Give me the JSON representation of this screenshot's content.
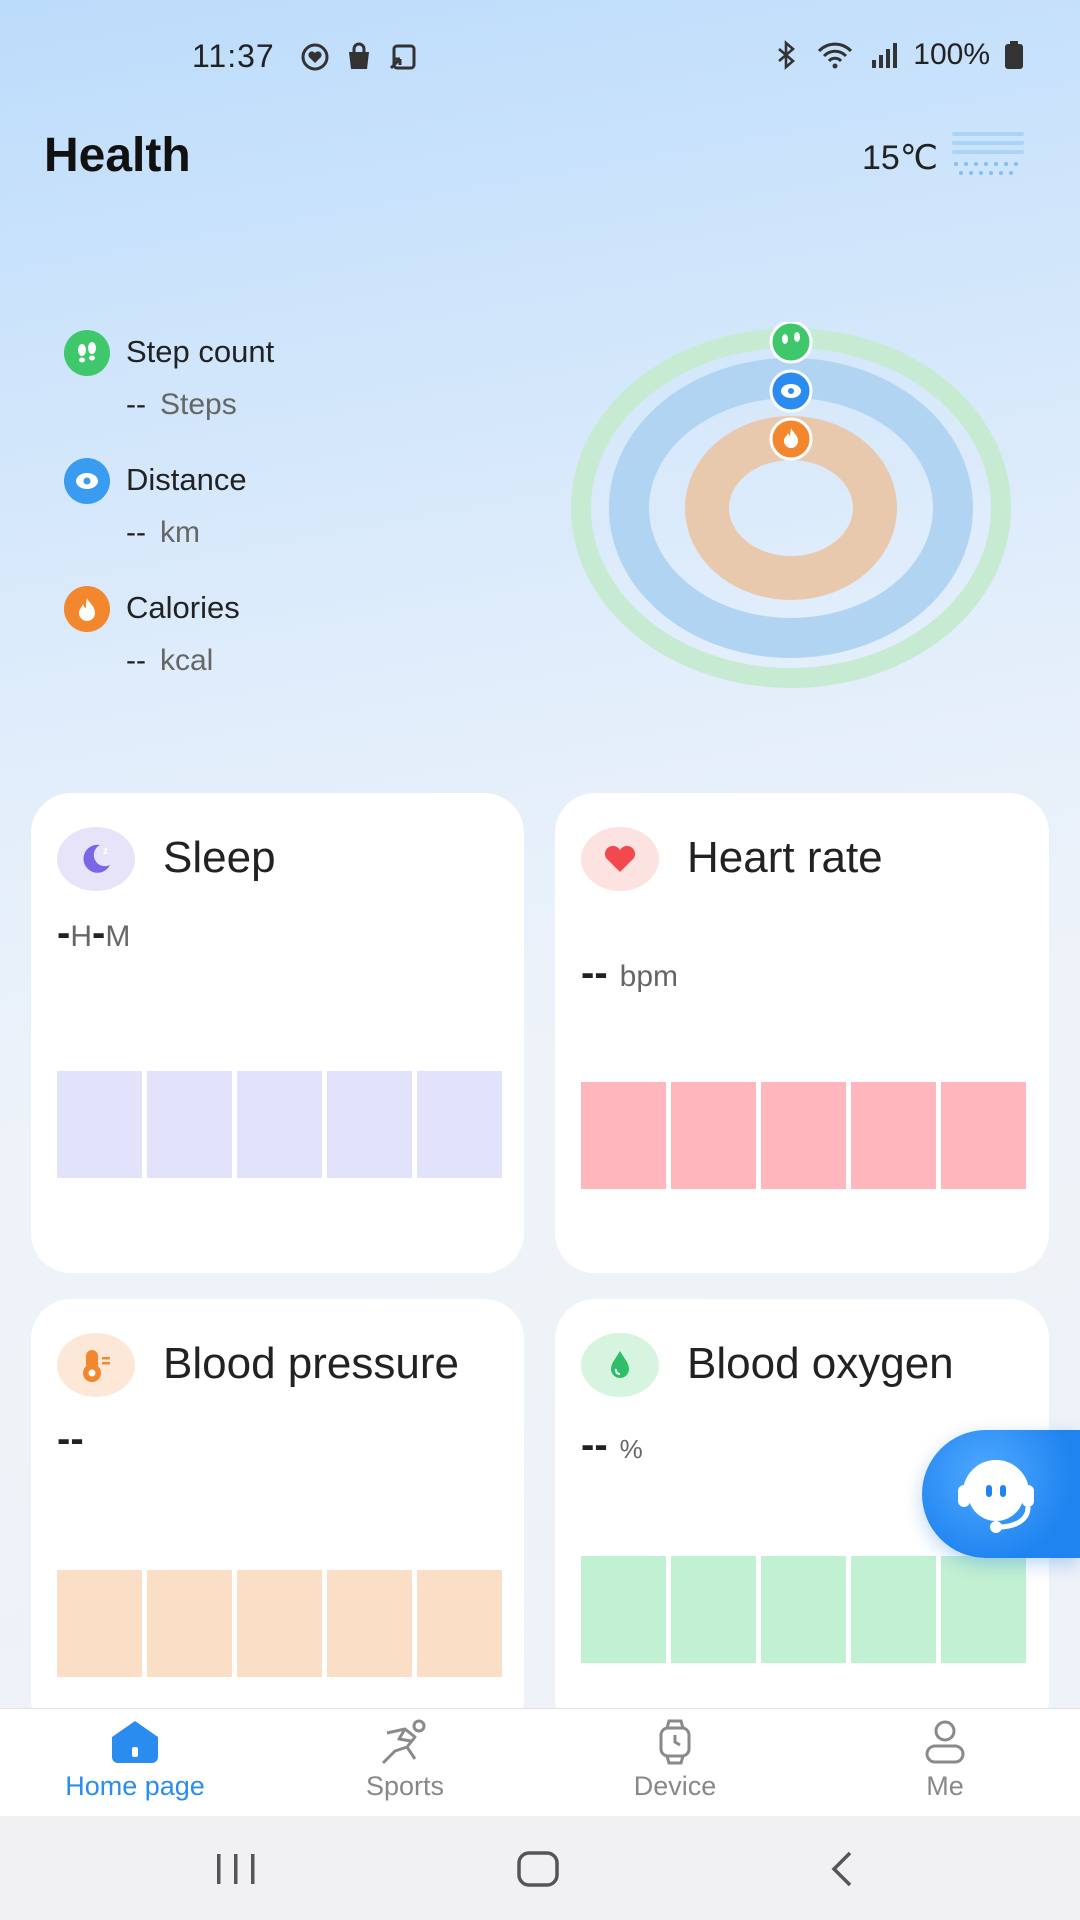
{
  "status_bar": {
    "time": "11:37",
    "battery": "100%"
  },
  "header": {
    "title": "Health",
    "temperature": "15℃",
    "weather_icon": "fog-icon"
  },
  "activity": [
    {
      "label": "Step count",
      "value": "--",
      "unit": "Steps",
      "icon": "footprints-icon",
      "color": "#3ec76b"
    },
    {
      "label": "Distance",
      "value": "--",
      "unit": "km",
      "icon": "location-icon",
      "color": "#3a9cf0"
    },
    {
      "label": "Calories",
      "value": "--",
      "unit": "kcal",
      "icon": "flame-icon",
      "color": "#f2872e"
    }
  ],
  "cards": {
    "sleep": {
      "title": "Sleep",
      "value_h": "-",
      "label_h": "H",
      "value_m": "-",
      "label_m": "M",
      "bar_color": "#e2e2fa"
    },
    "heart_rate": {
      "title": "Heart rate",
      "value": "--",
      "unit": "bpm",
      "bar_color": "#ffb7bd"
    },
    "blood_pressure": {
      "title": "Blood pressure",
      "value": "--",
      "bar_color": "#fadfc6"
    },
    "blood_oxygen": {
      "title": "Blood oxygen",
      "value": "--",
      "unit": "%",
      "bar_color": "#c2f0d2"
    }
  },
  "nav": [
    {
      "label": "Home page",
      "icon": "home-icon",
      "active": true
    },
    {
      "label": "Sports",
      "icon": "running-icon",
      "active": false
    },
    {
      "label": "Device",
      "icon": "watch-icon",
      "active": false
    },
    {
      "label": "Me",
      "icon": "person-icon",
      "active": false
    }
  ],
  "colors": {
    "accent": "#2b8cf0",
    "ring_steps": "#c6ebd2",
    "ring_distance": "#b0d4f1",
    "ring_calories": "#e9c9ad"
  }
}
